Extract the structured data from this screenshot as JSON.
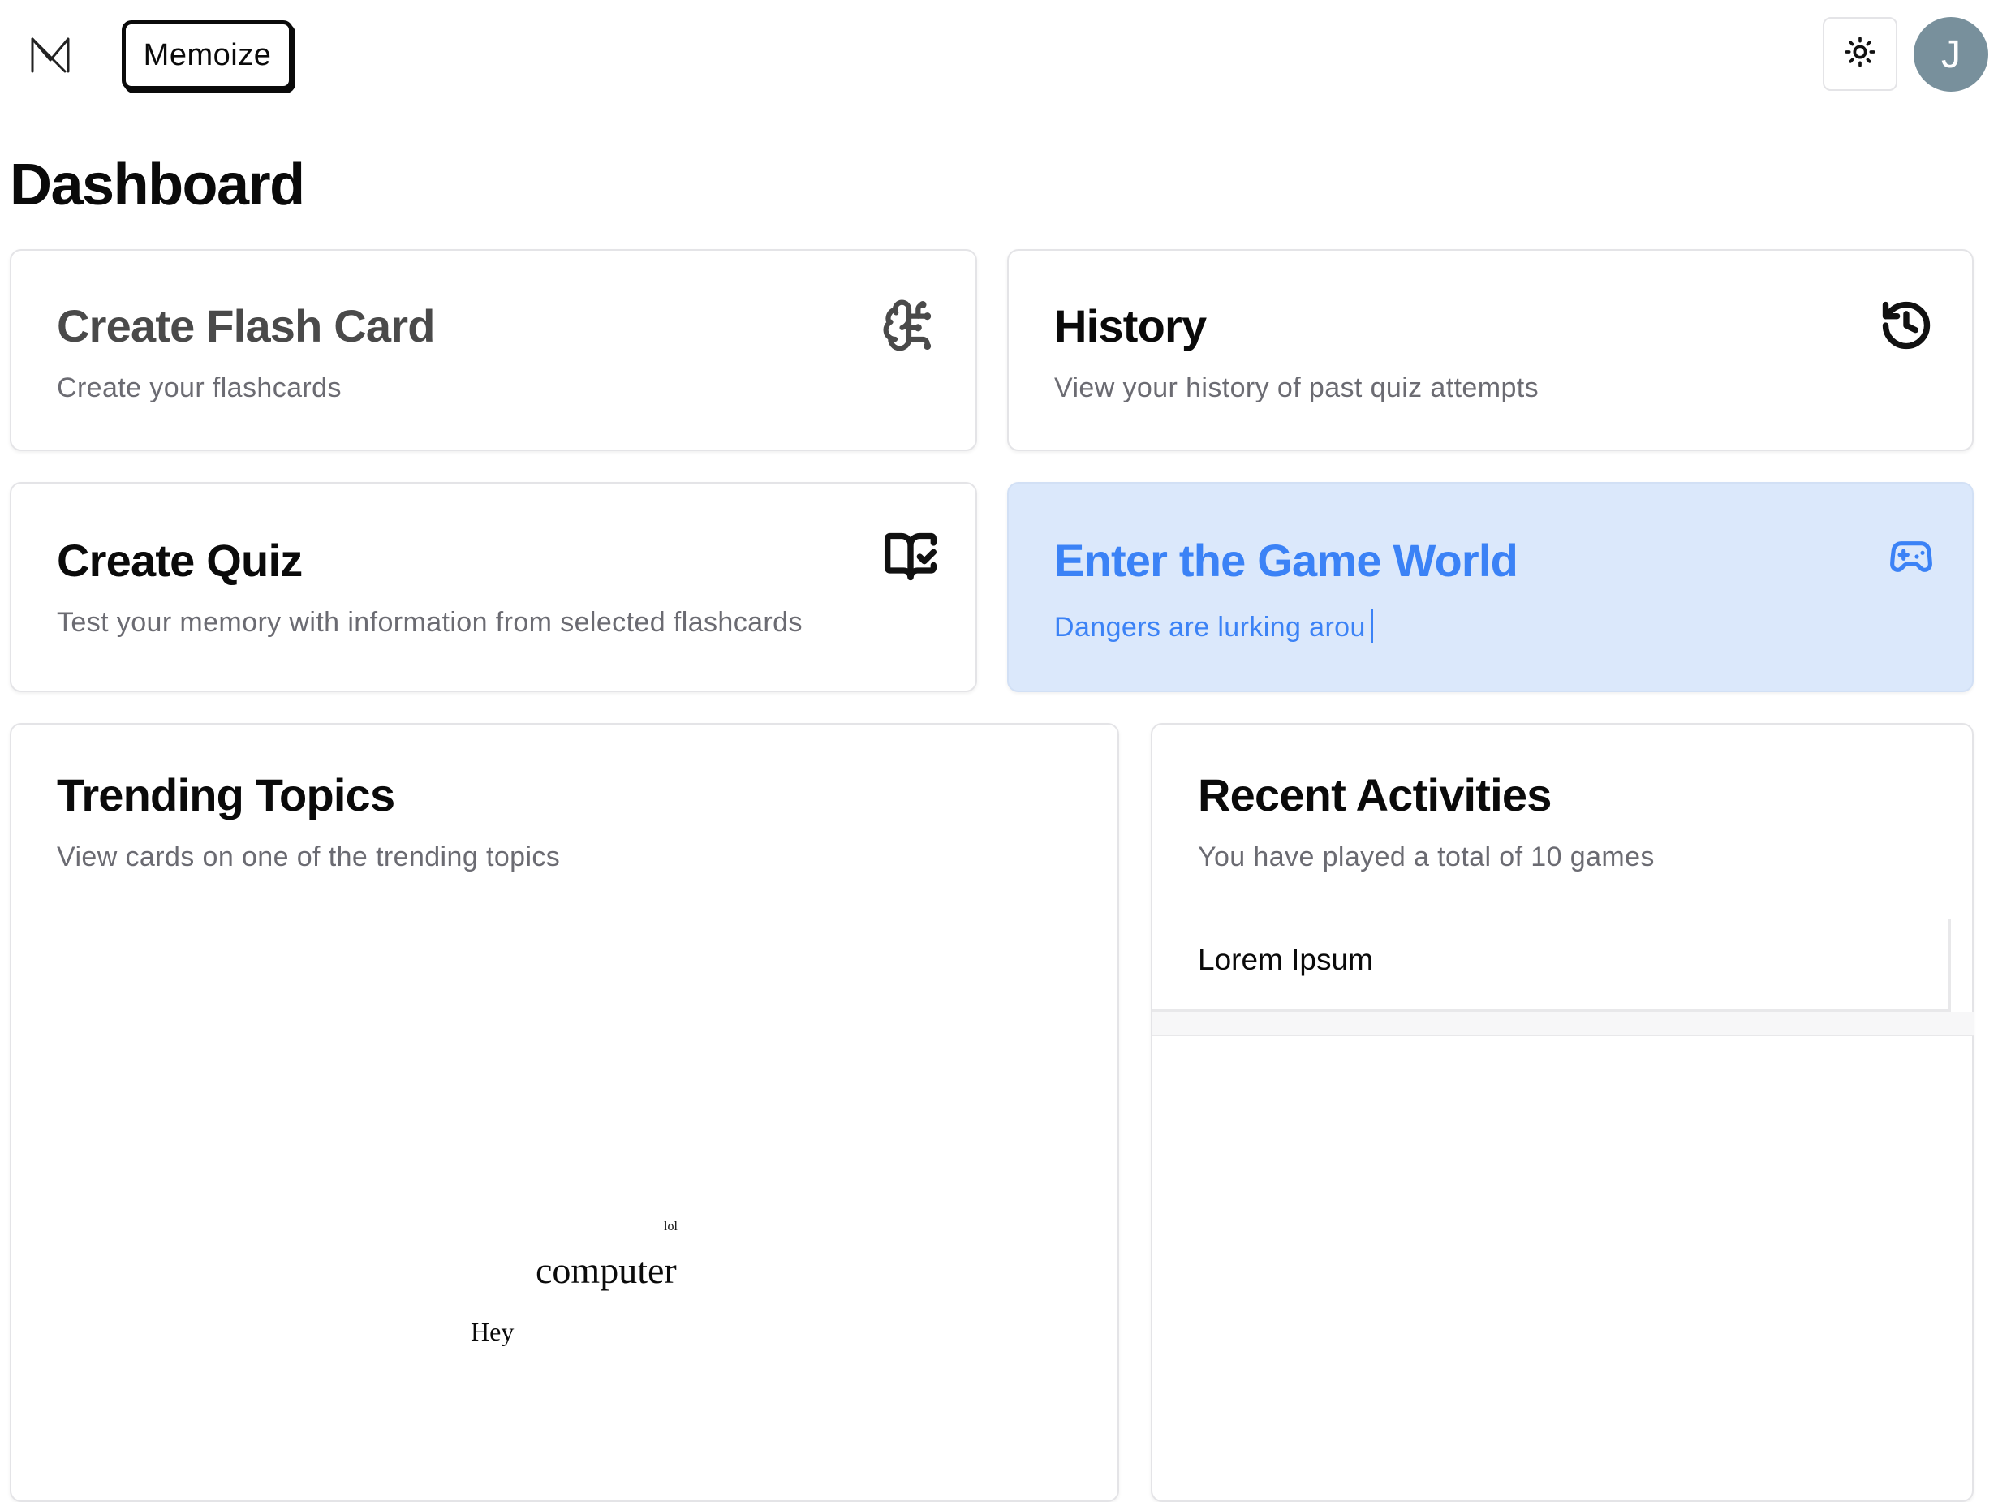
{
  "header": {
    "logo_icon": "memoize-m-logo-icon",
    "brand_label": "Memoize",
    "theme_icon": "sun-icon",
    "avatar_initial": "J"
  },
  "page": {
    "title": "Dashboard"
  },
  "cards": {
    "flash": {
      "title": "Create Flash Card",
      "description": "Create your flashcards",
      "icon": "brain-icon"
    },
    "history": {
      "title": "History",
      "description": "View your history of past quiz attempts",
      "icon": "history-icon"
    },
    "quiz": {
      "title": "Create Quiz",
      "description": "Test your memory with information from selected flashcards",
      "icon": "book-check-icon"
    },
    "game": {
      "title": "Enter the Game World",
      "description": "Dangers are lurking arou",
      "icon": "gamepad-icon",
      "accent_color": "#3b82f6",
      "background_color": "#dbe8fb"
    }
  },
  "trending": {
    "title": "Trending Topics",
    "description": "View cards on one of the trending topics",
    "words": [
      "lol",
      "computer",
      "Hey"
    ]
  },
  "recent": {
    "title": "Recent Activities",
    "description": "You have played a total of 10 games",
    "items": [
      {
        "label": "Lorem Ipsum"
      }
    ]
  },
  "colors": {
    "avatar": "#78909c",
    "border": "#e4e4e7",
    "muted_text": "#6b6b72"
  }
}
